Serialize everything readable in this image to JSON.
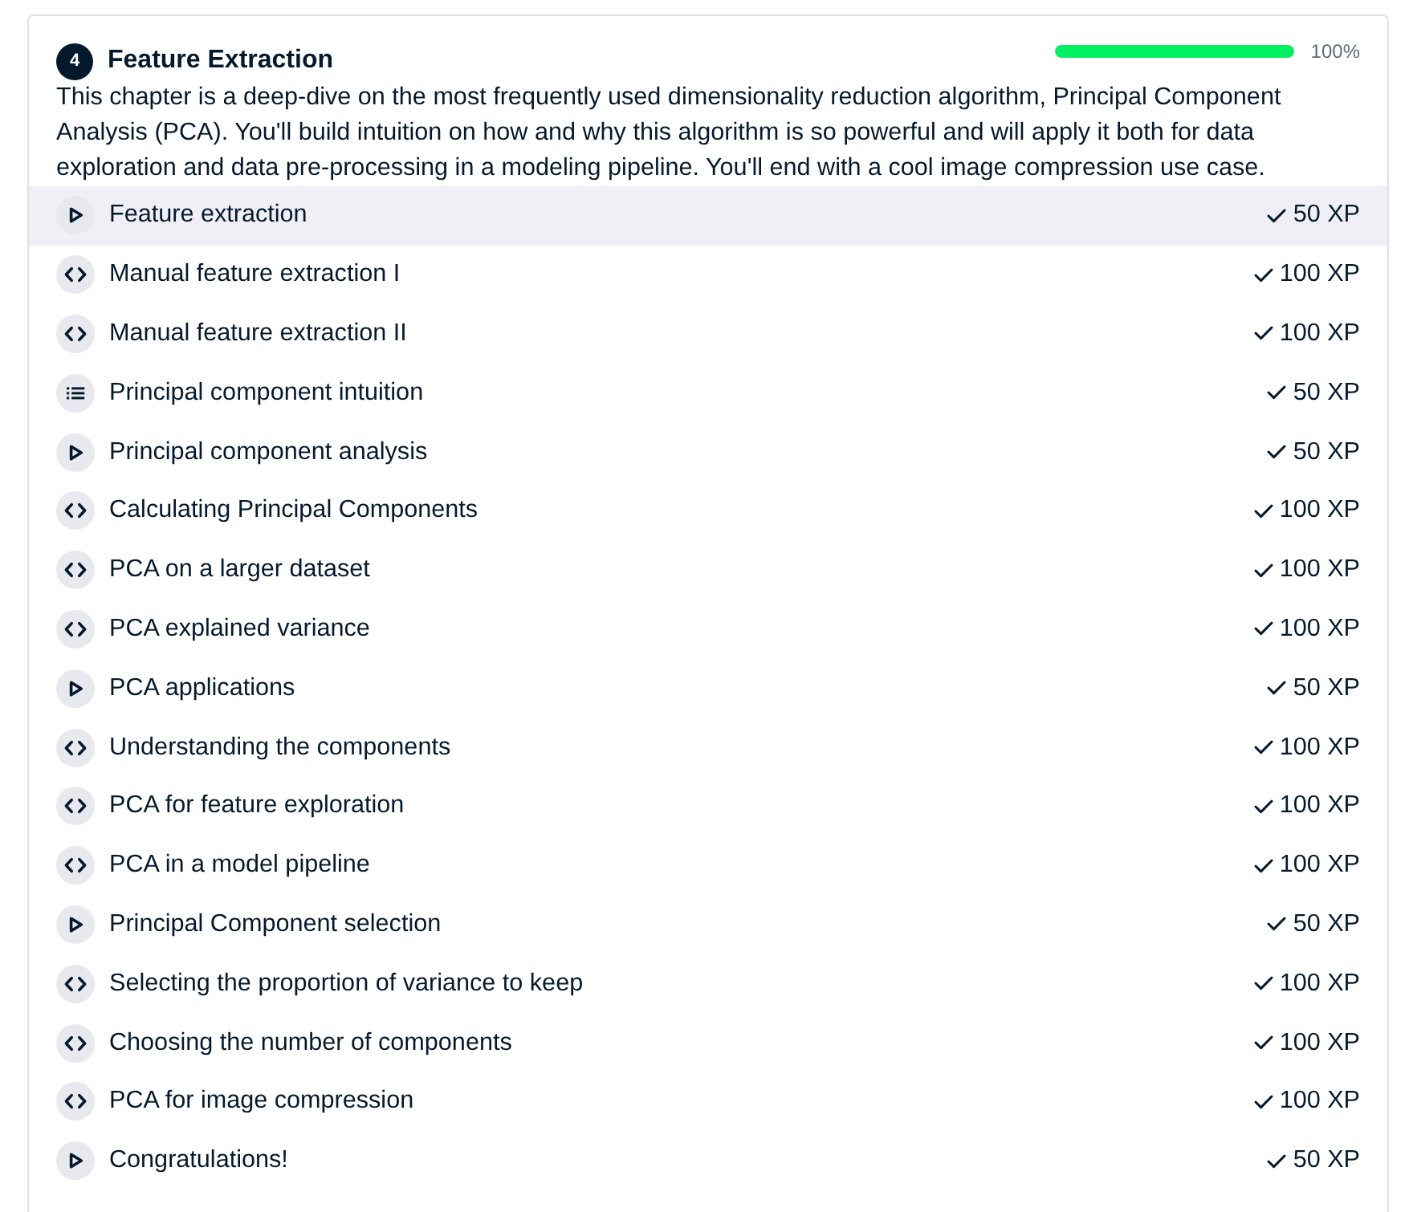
{
  "chapter": {
    "number": "4",
    "title": "Feature Extraction",
    "progress": {
      "level": 1,
      "reading": "100%"
    },
    "description": "This chapter is a deep-dive on the most frequently used dimensionality reduction algorithm, Principal Component Analysis (PCA). You'll build intuition on how and why this algorithm is so powerful and will apply it both for data exploration and data pre-processing in a modeling pipeline. You'll end with a cool image compression use case."
  },
  "lessons": [
    {
      "kind": "video",
      "title": "Feature extraction",
      "xp": "50 XP",
      "completed": true,
      "selected": true
    },
    {
      "kind": "exercise",
      "title": "Manual feature extraction I",
      "xp": "100 XP",
      "completed": true,
      "selected": false
    },
    {
      "kind": "exercise",
      "title": "Manual feature extraction II",
      "xp": "100 XP",
      "completed": true,
      "selected": false
    },
    {
      "kind": "quiz",
      "title": "Principal component intuition",
      "xp": "50 XP",
      "completed": true,
      "selected": false
    },
    {
      "kind": "video",
      "title": "Principal component analysis",
      "xp": "50 XP",
      "completed": true,
      "selected": false
    },
    {
      "kind": "exercise",
      "title": "Calculating Principal Components",
      "xp": "100 XP",
      "completed": true,
      "selected": false
    },
    {
      "kind": "exercise",
      "title": "PCA on a larger dataset",
      "xp": "100 XP",
      "completed": true,
      "selected": false
    },
    {
      "kind": "exercise",
      "title": "PCA explained variance",
      "xp": "100 XP",
      "completed": true,
      "selected": false
    },
    {
      "kind": "video",
      "title": "PCA applications",
      "xp": "50 XP",
      "completed": true,
      "selected": false
    },
    {
      "kind": "exercise",
      "title": "Understanding the components",
      "xp": "100 XP",
      "completed": true,
      "selected": false
    },
    {
      "kind": "exercise",
      "title": "PCA for feature exploration",
      "xp": "100 XP",
      "completed": true,
      "selected": false
    },
    {
      "kind": "exercise",
      "title": "PCA in a model pipeline",
      "xp": "100 XP",
      "completed": true,
      "selected": false
    },
    {
      "kind": "video",
      "title": "Principal Component selection",
      "xp": "50 XP",
      "completed": true,
      "selected": false
    },
    {
      "kind": "exercise",
      "title": "Selecting the proportion of variance to keep",
      "xp": "100 XP",
      "completed": true,
      "selected": false
    },
    {
      "kind": "exercise",
      "title": "Choosing the number of components",
      "xp": "100 XP",
      "completed": true,
      "selected": false
    },
    {
      "kind": "exercise",
      "title": "PCA for image compression",
      "xp": "100 XP",
      "completed": true,
      "selected": false
    },
    {
      "kind": "video",
      "title": "Congratulations!",
      "xp": "50 XP",
      "completed": true,
      "selected": false
    }
  ]
}
